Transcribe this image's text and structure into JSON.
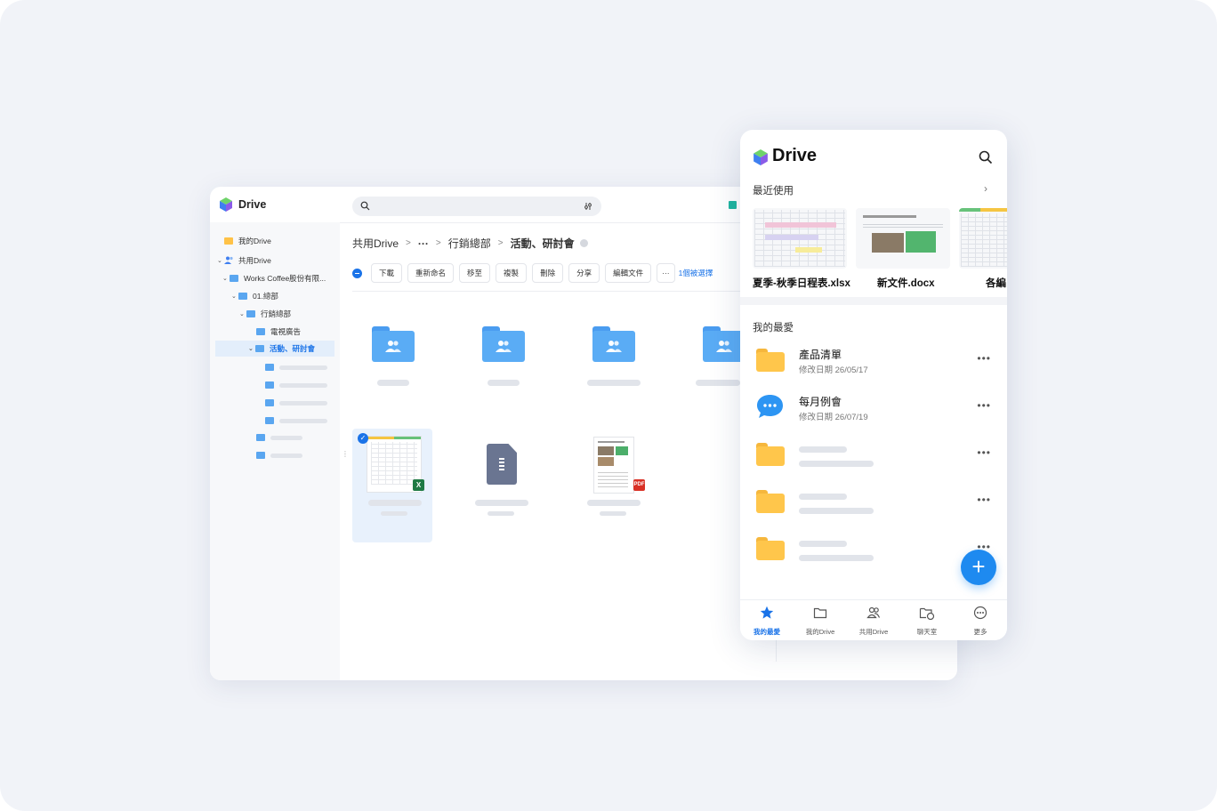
{
  "desktop": {
    "app_name": "Drive",
    "sidebar": {
      "my_drive": "我的Drive",
      "shared_drive": "共用Drive",
      "works_coffee": "Works Coffee股份有限...",
      "dept_01": "01.總部",
      "marketing": "行銷總部",
      "tv_ads": "電視廣告",
      "events": "活動、研討會"
    },
    "breadcrumb": {
      "root": "共用Drive",
      "ellipsis": "···",
      "parent": "行銷總部",
      "current": "活動、研討會"
    },
    "toolbar": {
      "download": "下載",
      "rename": "重新命名",
      "move": "移至",
      "copy": "複製",
      "delete": "刪除",
      "share": "分享",
      "edit_doc": "編輯文件",
      "more": "···",
      "selected": "1個被選擇"
    },
    "file_badges": {
      "excel": "X",
      "pdf": "PDF"
    }
  },
  "mobile": {
    "app_name": "Drive",
    "recent_title": "最近使用",
    "recent": [
      {
        "name": "夏季-秋季日程表.xlsx"
      },
      {
        "name": "新文件.docx"
      },
      {
        "name": "各編"
      }
    ],
    "favorites_title": "我的最愛",
    "favorites": [
      {
        "name": "產品清單",
        "date": "修改日期 26/05/17"
      },
      {
        "name": "每月例會",
        "date": "修改日期 26/07/19"
      }
    ],
    "more_dots": "•••",
    "fab": "+",
    "nav": [
      {
        "label": "我的最愛"
      },
      {
        "label": "我的Drive"
      },
      {
        "label": "共用Drive"
      },
      {
        "label": "聊天室"
      },
      {
        "label": "更多"
      }
    ]
  },
  "colors": {
    "accent": "#1a73e8",
    "folder_blue": "#5aacf5",
    "folder_yellow": "#ffc64b",
    "background": "#f1f3f8"
  }
}
